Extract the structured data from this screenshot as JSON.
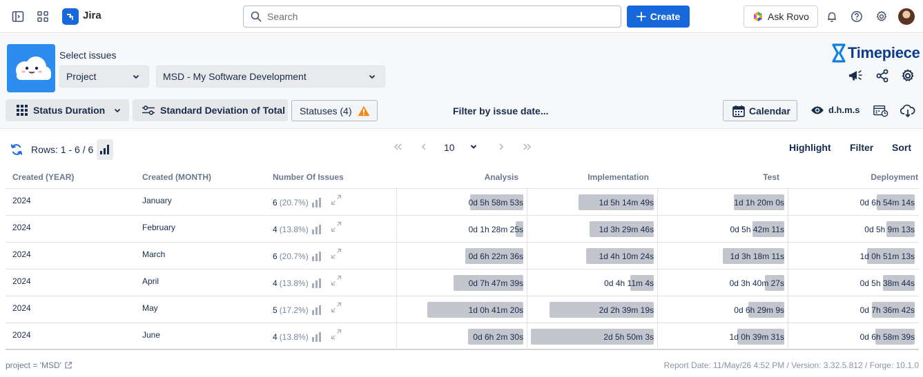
{
  "topnav": {
    "app_name": "Jira",
    "search_placeholder": "Search",
    "create_label": "Create",
    "rovo_label": "Ask Rovo",
    "brand_color": "#1868db"
  },
  "selector": {
    "label": "Select issues",
    "type_value": "Project",
    "project_value": "MSD - My Software Development"
  },
  "brand": {
    "name": "Timepiece"
  },
  "toolbar": {
    "status_duration": "Status Duration",
    "std_dev": "Standard Deviation of Total",
    "statuses": "Statuses (4)",
    "filter_date": "Filter by issue date...",
    "calendar": "Calendar",
    "dhms": "d.h.m.s"
  },
  "table_toolbar": {
    "rows_label": "Rows: 1 - 6 / 6",
    "page_size": "10",
    "highlight": "Highlight",
    "filter": "Filter",
    "sort": "Sort"
  },
  "table": {
    "headers": [
      "Created (YEAR)",
      "Created (MONTH)",
      "Number Of Issues",
      "Analysis",
      "Implementation",
      "Test",
      "Deployment"
    ],
    "rows": [
      {
        "year": "2024",
        "month": "January",
        "count": "6",
        "pct": "(20.7%)",
        "d": [
          [
            "0d 5h 58m 53s",
            0.43
          ],
          [
            "1d 5h 14m 49s",
            0.61
          ],
          [
            "1d 1h 20m 0s",
            0.41
          ],
          [
            "0d 6h 54m 14s",
            0.31
          ]
        ]
      },
      {
        "year": "2024",
        "month": "February",
        "count": "4",
        "pct": "(13.8%)",
        "d": [
          [
            "0d 1h 28m 25s",
            0.06
          ],
          [
            "1d 3h 29m 46s",
            0.52
          ],
          [
            "0d 5h 42m 11s",
            0.26
          ],
          [
            "0d 5h 9m 13s",
            0.23
          ]
        ]
      },
      {
        "year": "2024",
        "month": "March",
        "count": "6",
        "pct": "(20.7%)",
        "d": [
          [
            "0d 6h 22m 36s",
            0.47
          ],
          [
            "1d 4h 10m 24s",
            0.55
          ],
          [
            "1d 3h 18m 11s",
            0.5
          ],
          [
            "1d 0h 51m 13s",
            0.39
          ]
        ]
      },
      {
        "year": "2024",
        "month": "April",
        "count": "4",
        "pct": "(13.8%)",
        "d": [
          [
            "0d 7h 47m 39s",
            0.57
          ],
          [
            "0d 4h 11m 4s",
            0.19
          ],
          [
            "0d 3h 40m 27s",
            0.16
          ],
          [
            "0d 5h 38m 44s",
            0.26
          ]
        ]
      },
      {
        "year": "2024",
        "month": "May",
        "count": "5",
        "pct": "(17.2%)",
        "d": [
          [
            "1d 0h 41m 20s",
            0.78
          ],
          [
            "2d 2h 39m 19s",
            0.85
          ],
          [
            "0d 6h 29m 9s",
            0.29
          ],
          [
            "0d 7h 36m 42s",
            0.35
          ]
        ]
      },
      {
        "year": "2024",
        "month": "June",
        "count": "4",
        "pct": "(13.8%)",
        "d": [
          [
            "0d 6h 2m 30s",
            0.45
          ],
          [
            "2d 5h 50m 3s",
            1.0
          ],
          [
            "1d 0h 39m 31s",
            0.38
          ],
          [
            "0d 6h 58m 39s",
            0.32
          ]
        ]
      }
    ]
  },
  "footer": {
    "query": "project = 'MSD'",
    "report": "Report Date: 11/May/26 4:52 PM / Version: 3.32.5.812 / Forge: 10.1.0"
  },
  "icons": {
    "sidebar": "sidebar-toggle-icon",
    "apps": "app-switcher-icon",
    "search": "search-icon",
    "bell": "bell-icon",
    "help": "help-icon",
    "settings": "gear-icon",
    "refresh": "refresh-icon",
    "warning": "warning-icon",
    "eye": "eye-icon"
  }
}
